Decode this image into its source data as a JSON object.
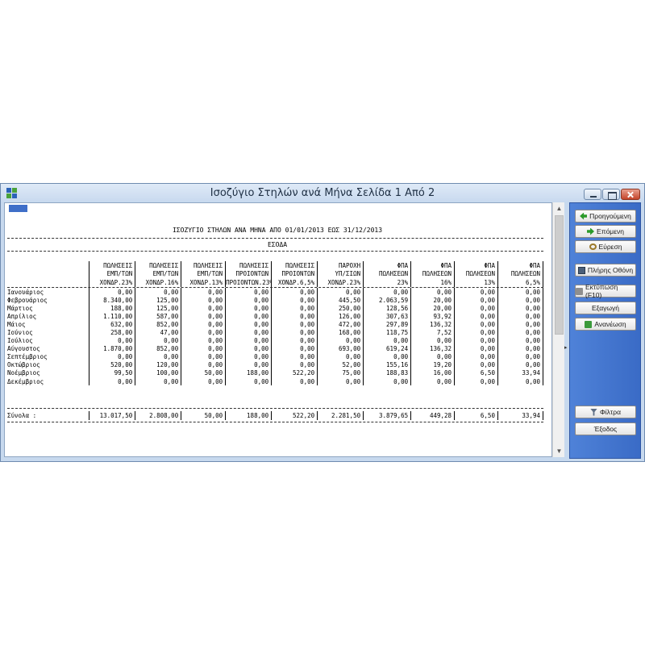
{
  "window": {
    "title": "Ισοζύγιο Στηλών ανά Μήνα Σελίδα 1 Από 2"
  },
  "report": {
    "heading": "ΙΣΟΖΥΓΙΟ ΣΤΗΛΩΝ ΑΝΑ ΜΗΝΑ ΑΠΟ 01/01/2013 ΕΩΣ 31/12/2013",
    "section": "ΕΣΟΔΑ",
    "column_headers": [
      [
        "ΠΩΛΗΣΕΙΣ",
        "ΕΜΠ/ΤΩΝ",
        "ΧΟΝΔΡ.23%"
      ],
      [
        "ΠΩΛΗΣΕΙΣ",
        "ΕΜΠ/ΤΩΝ",
        "ΧΟΝΔΡ.16%"
      ],
      [
        "ΠΩΛΗΣΕΙΣ",
        "ΕΜΠ/ΤΩΝ",
        "ΧΟΝΔΡ.13%"
      ],
      [
        "ΠΩΛΗΣΕΙΣ",
        "ΠΡΟΙΟΝΤΩΝ",
        "ΠΡΟΙΟΝΤΩΝ.23%"
      ],
      [
        "ΠΩΛΗΣΕΙΣ",
        "ΠΡΟΙΟΝΤΩΝ",
        "ΧΟΝΔΡ.6,5%"
      ],
      [
        "ΠΑΡΟΧΗ",
        "ΥΠ/ΣΙΩΝ",
        "ΧΟΝΔΡ.23%"
      ],
      [
        "ΦΠΑ",
        "ΠΩΛΗΣΕΩΝ",
        "23%"
      ],
      [
        "ΦΠΑ",
        "ΠΩΛΗΣΕΩΝ",
        "16%"
      ],
      [
        "ΦΠΑ",
        "ΠΩΛΗΣΕΩΝ",
        "13%"
      ],
      [
        "ΦΠΑ",
        "ΠΩΛΗΣΕΩΝ",
        "6,5%"
      ]
    ],
    "rows": [
      {
        "month": "Ιανουάριος",
        "values": [
          "0,00",
          "0,00",
          "0,00",
          "0,00",
          "0,00",
          "0,00",
          "0,00",
          "0,00",
          "0,00",
          "0,00"
        ]
      },
      {
        "month": "Φεβρουάριος",
        "values": [
          "8.340,00",
          "125,00",
          "0,00",
          "0,00",
          "0,00",
          "445,50",
          "2.063,59",
          "20,00",
          "0,00",
          "0,00"
        ]
      },
      {
        "month": "Μάρτιος",
        "values": [
          "188,00",
          "125,00",
          "0,00",
          "0,00",
          "0,00",
          "250,00",
          "128,56",
          "20,00",
          "0,00",
          "0,00"
        ]
      },
      {
        "month": "Απρίλιος",
        "values": [
          "1.110,00",
          "587,00",
          "0,00",
          "0,00",
          "0,00",
          "126,00",
          "307,63",
          "93,92",
          "0,00",
          "0,00"
        ]
      },
      {
        "month": "Μάιος",
        "values": [
          "632,00",
          "852,00",
          "0,00",
          "0,00",
          "0,00",
          "472,00",
          "297,89",
          "136,32",
          "0,00",
          "0,00"
        ]
      },
      {
        "month": "Ιούνιος",
        "values": [
          "258,00",
          "47,00",
          "0,00",
          "0,00",
          "0,00",
          "168,00",
          "118,75",
          "7,52",
          "0,00",
          "0,00"
        ]
      },
      {
        "month": "Ιούλιος",
        "values": [
          "0,00",
          "0,00",
          "0,00",
          "0,00",
          "0,00",
          "0,00",
          "0,00",
          "0,00",
          "0,00",
          "0,00"
        ]
      },
      {
        "month": "Αύγουστος",
        "values": [
          "1.870,00",
          "852,00",
          "0,00",
          "0,00",
          "0,00",
          "693,00",
          "619,24",
          "136,32",
          "0,00",
          "0,00"
        ]
      },
      {
        "month": "Σεπτέμβριος",
        "values": [
          "0,00",
          "0,00",
          "0,00",
          "0,00",
          "0,00",
          "0,00",
          "0,00",
          "0,00",
          "0,00",
          "0,00"
        ]
      },
      {
        "month": "Οκτώβριος",
        "values": [
          "520,00",
          "120,00",
          "0,00",
          "0,00",
          "0,00",
          "52,00",
          "155,16",
          "19,20",
          "0,00",
          "0,00"
        ]
      },
      {
        "month": "Νοέμβριος",
        "values": [
          "99,50",
          "100,00",
          "50,00",
          "188,00",
          "522,20",
          "75,00",
          "188,83",
          "16,00",
          "6,50",
          "33,94"
        ]
      },
      {
        "month": "Δεκέμβριος",
        "values": [
          "0,00",
          "0,00",
          "0,00",
          "0,00",
          "0,00",
          "0,00",
          "0,00",
          "0,00",
          "0,00",
          "0,00"
        ]
      }
    ],
    "totals": {
      "label": "Σύνολα :",
      "values": [
        "13.017,50",
        "2.808,00",
        "50,00",
        "188,00",
        "522,20",
        "2.281,50",
        "3.879,65",
        "449,28",
        "6,50",
        "33,94"
      ]
    }
  },
  "side_panel": {
    "buttons": [
      {
        "label": "Προηγούμενη",
        "icon": "arrow-left-icon"
      },
      {
        "label": "Επόμενη",
        "icon": "arrow-right-icon"
      },
      {
        "label": "Εύρεση",
        "icon": "search-icon"
      },
      {
        "label": "Πλήρης Οθόνη",
        "icon": "monitor-icon"
      },
      {
        "label": "Εκτύπωση (F10)",
        "icon": "printer-icon"
      },
      {
        "label": "Εξαγωγή",
        "icon": ""
      },
      {
        "label": "Ανανέωση",
        "icon": "refresh-icon"
      },
      {
        "label": "Φίλτρα",
        "icon": "filter-icon"
      },
      {
        "label": "Έξοδος",
        "icon": ""
      }
    ]
  },
  "colors": {
    "side_panel": "#4a7dd4",
    "frame": "#c7d9ee",
    "marker": "#3f6fc8"
  }
}
